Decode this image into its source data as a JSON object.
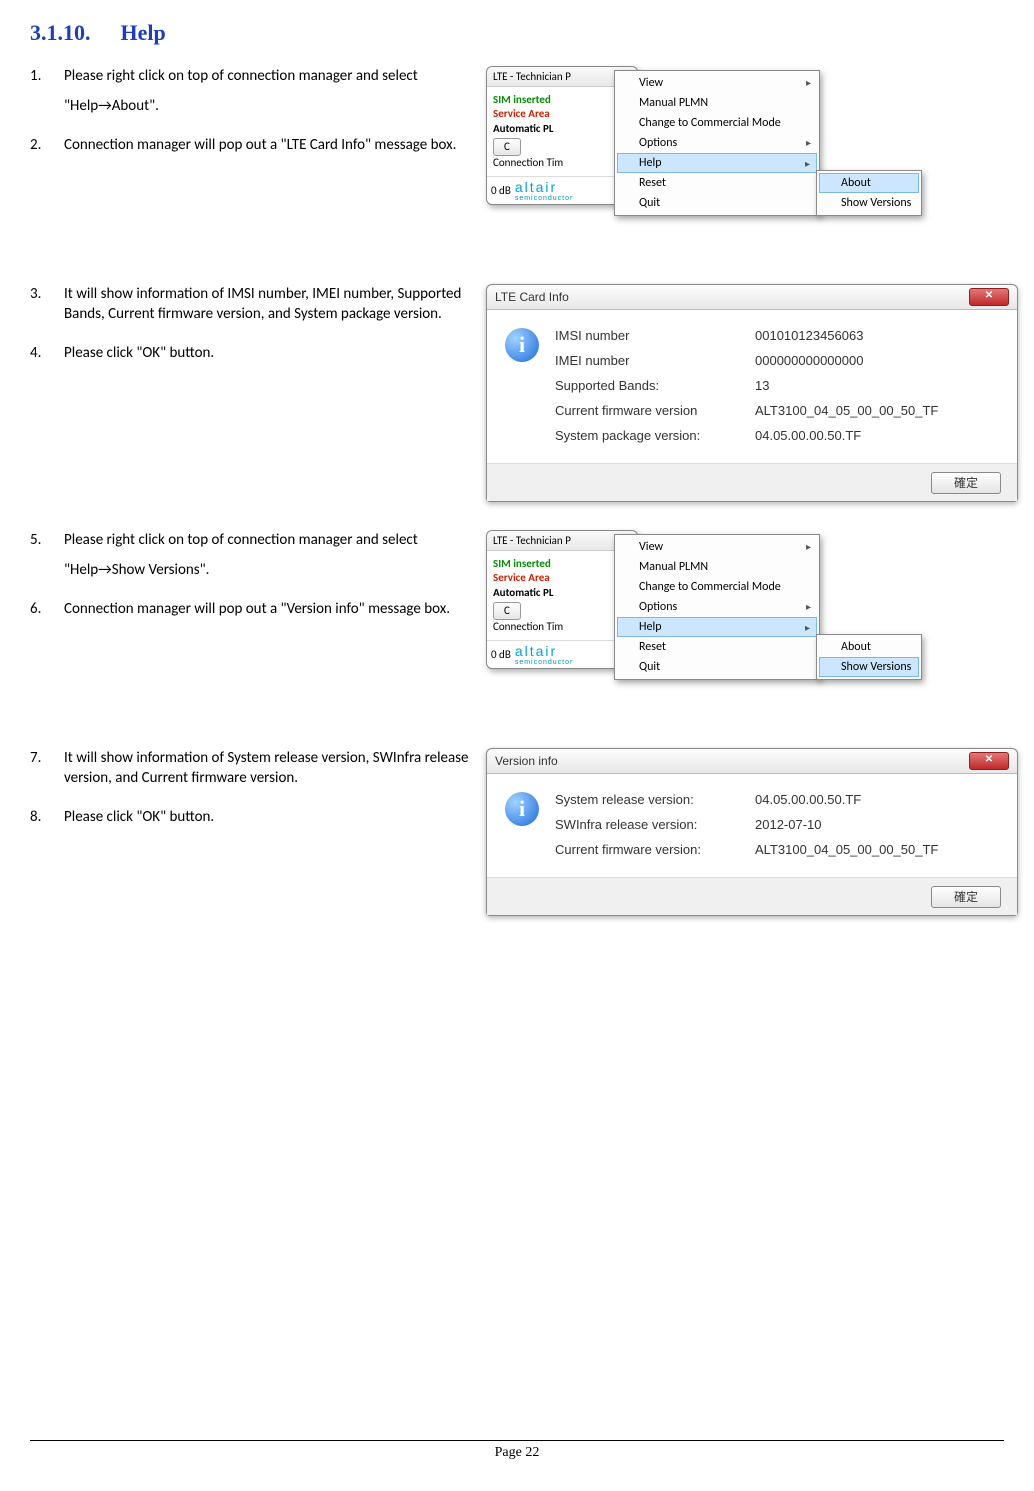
{
  "heading": {
    "number": "3.1.10.",
    "title": "Help"
  },
  "steps": {
    "s1a": "Please right click on top of connection manager and select",
    "s1b": "\"Help→About\".",
    "s2": "Connection manager will pop out a \"LTE Card Info\" message box.",
    "s3": "It will show information of IMSI number, IMEI number, Supported Bands, Current firmware version, and System package version.",
    "s4": "Please click \"OK\" button.",
    "s5a": "Please right click on top of connection manager and select",
    "s5b": "\"Help→Show Versions\".",
    "s6": "Connection manager will pop out a \"Version info\" message box.",
    "s7": "It will show information of System release version, SWInfra release version, and Current firmware version.",
    "s8": "Please click \"OK\" button."
  },
  "cm": {
    "title": "LTE - Technician P",
    "sim": "SIM inserted",
    "service": "Service Area",
    "auto": "Automatic PL",
    "connect_btn": "C",
    "conn_time": "Connection Tim",
    "signal": "0 dB",
    "brand": "altair",
    "brand_sub": "semiconductor"
  },
  "menu": {
    "view": "View",
    "manual_plmn": "Manual PLMN",
    "commercial": "Change to Commercial Mode",
    "options": "Options",
    "help": "Help",
    "reset": "Reset",
    "quit": "Quit",
    "about": "About",
    "show_versions": "Show Versions"
  },
  "card_info": {
    "title": "LTE Card Info",
    "imsi_label": "IMSI number",
    "imsi_value": "001010123456063",
    "imei_label": "IMEI number",
    "imei_value": "000000000000000",
    "bands_label": "Supported Bands:",
    "bands_value": "13",
    "fw_label": "Current firmware version",
    "fw_value": "ALT3100_04_05_00_00_50_TF",
    "pkg_label": "System package version:",
    "pkg_value": "04.05.00.00.50.TF",
    "ok": "確定"
  },
  "version_info": {
    "title": "Version info",
    "sys_label": "System release version:",
    "sys_value": "04.05.00.00.50.TF",
    "sw_label": "SWInfra release version:",
    "sw_value": "2012-07-10",
    "fw_label": "Current firmware version:",
    "fw_value": "ALT3100_04_05_00_00_50_TF",
    "ok": "確定"
  },
  "footer": "Page 22"
}
